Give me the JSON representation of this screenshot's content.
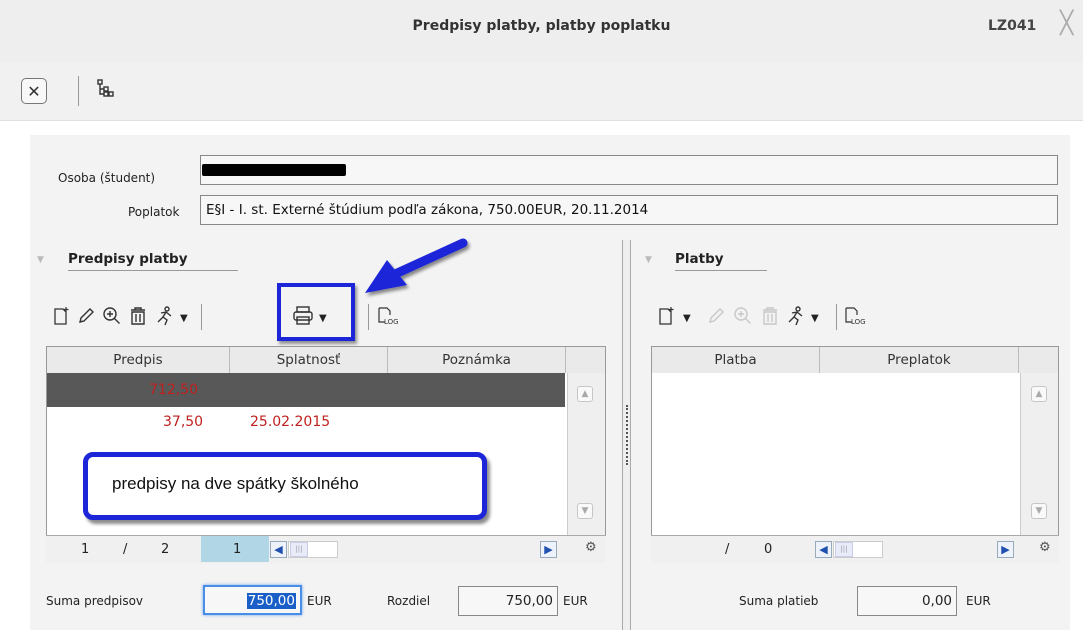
{
  "window": {
    "title": "Predpisy platby, platby poplatku",
    "code": "LZ041",
    "close_glyph": "╳"
  },
  "toolbar": {
    "close_icon": "close-icon",
    "tree_icon": "hierarchy-icon"
  },
  "form": {
    "osoba_label": "Osoba (študent)",
    "osoba_value": "",
    "poplatok_label": "Poplatok",
    "poplatok_value": "E§I - I. st. Externé štúdium podľa zákona, 750.00EUR, 20.11.2014"
  },
  "left_panel": {
    "title": "Predpisy platby",
    "icons": [
      "new-icon",
      "edit-icon",
      "zoom-icon",
      "delete-icon",
      "run-icon",
      "print-icon",
      "log-icon"
    ],
    "columns": [
      "Predpis",
      "Splatnosť",
      "Poznámka"
    ],
    "rows": [
      {
        "predpis": "712,50",
        "splatnost": "",
        "poznamka": "",
        "selected": true
      },
      {
        "predpis": "37,50",
        "splatnost": "25.02.2015",
        "poznamka": "",
        "selected": false
      }
    ],
    "pager": {
      "current": "1",
      "sep": "/",
      "total": "2",
      "page": "1"
    },
    "sum_label": "Suma predpisov",
    "sum_value": "750,00",
    "sum_unit": "EUR",
    "diff_label": "Rozdiel",
    "diff_value": "750,00",
    "diff_unit": "EUR"
  },
  "right_panel": {
    "title": "Platby",
    "columns": [
      "Platba",
      "Preplatok"
    ],
    "pager": {
      "sep": "/",
      "total": "0"
    },
    "sum_label": "Suma platieb",
    "sum_value": "0,00",
    "sum_unit": "EUR"
  },
  "annotation": {
    "callout_text": "predpisy na dve spátky školného",
    "color": "#1c25d8"
  }
}
